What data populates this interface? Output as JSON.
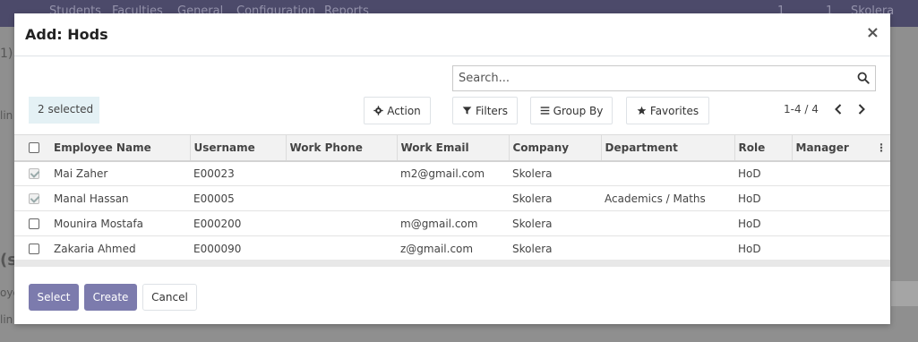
{
  "background": {
    "nav": [
      "Students",
      "Faculties",
      "General",
      "Configuration",
      "Reports"
    ],
    "badge_1": "1",
    "badge_2": "1",
    "company": "Skolera",
    "fragment_1": "1)",
    "fragment_2": "lin",
    "fragment_3": "(s",
    "fragment_4": "oye",
    "fragment_5": "lin"
  },
  "modal": {
    "title": "Add: Hods",
    "close_label": "×"
  },
  "search": {
    "placeholder": "Search..."
  },
  "selection": {
    "label": "2 selected"
  },
  "toolbar": {
    "action_label": "Action",
    "filters_label": "Filters",
    "groupby_label": "Group By",
    "favorites_label": "Favorites"
  },
  "pager": {
    "range": "1-4 / 4"
  },
  "table": {
    "columns": [
      "Employee Name",
      "Username",
      "Work Phone",
      "Work Email",
      "Company",
      "Department",
      "Role",
      "Manager"
    ],
    "rows": [
      {
        "checked": true,
        "name": "Mai Zaher",
        "username": "E00023",
        "phone": "",
        "email": "m2@gmail.com",
        "company": "Skolera",
        "department": "",
        "role": "HoD",
        "manager": ""
      },
      {
        "checked": true,
        "name": "Manal Hassan",
        "username": "E00005",
        "phone": "",
        "email": "",
        "company": "Skolera",
        "department": "Academics / Maths",
        "role": "HoD",
        "manager": ""
      },
      {
        "checked": false,
        "name": "Mounira Mostafa",
        "username": "E000200",
        "phone": "",
        "email": "m@gmail.com",
        "company": "Skolera",
        "department": "",
        "role": "HoD",
        "manager": ""
      },
      {
        "checked": false,
        "name": "Zakaria Ahmed",
        "username": "E000090",
        "phone": "",
        "email": "z@gmail.com",
        "company": "Skolera",
        "department": "",
        "role": "HoD",
        "manager": ""
      }
    ]
  },
  "footer": {
    "select_label": "Select",
    "create_label": "Create",
    "cancel_label": "Cancel"
  },
  "colors": {
    "primary": "#7c7bad",
    "selected_bg": "#e4f1f5",
    "topbar": "#4c4a6a"
  },
  "icons": [
    "search-icon",
    "gear-icon",
    "filter-icon",
    "list-icon",
    "star-icon",
    "chevron-left-icon",
    "chevron-right-icon",
    "close-icon",
    "kebab-icon"
  ]
}
